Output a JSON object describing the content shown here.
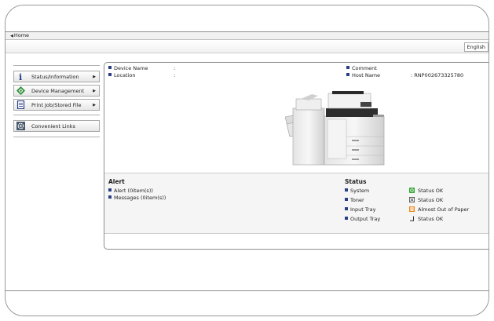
{
  "breadcrumb": {
    "home": "Home"
  },
  "header": {
    "language": "English"
  },
  "sidebar": {
    "items": [
      {
        "label": "Status/Information",
        "icon": "info-icon"
      },
      {
        "label": "Device Management",
        "icon": "diamond-icon"
      },
      {
        "label": "Print Job/Stored File",
        "icon": "document-icon"
      }
    ],
    "links": {
      "label": "Convenient Links",
      "icon": "gear-icon"
    }
  },
  "device": {
    "name_label": "Device Name",
    "name_sep": ":",
    "name_value": "",
    "location_label": "Location",
    "location_sep": ":",
    "location_value": "",
    "comment_label": "Comment",
    "comment_value": "",
    "host_label": "Host Name",
    "host_value": ": RNP002673325780"
  },
  "alert": {
    "title": "Alert",
    "items": [
      "Alert (0item(s))",
      "Messages (0item(s))"
    ]
  },
  "status": {
    "title": "Status",
    "rows": [
      {
        "label": "System",
        "value": "Status OK",
        "icon": "system-ok-icon",
        "color": "#2fa52f"
      },
      {
        "label": "Toner",
        "value": "Status OK",
        "icon": "toner-icon",
        "color": "#555555"
      },
      {
        "label": "Input Tray",
        "value": "Almost Out of Paper",
        "icon": "paper-warning-icon",
        "color": "#f08a1c"
      },
      {
        "label": "Output Tray",
        "value": "Status OK",
        "icon": "output-tray-icon",
        "color": "#333333"
      }
    ]
  },
  "colors": {
    "bullet": "#2b3f86",
    "border": "#8f8f8f"
  }
}
